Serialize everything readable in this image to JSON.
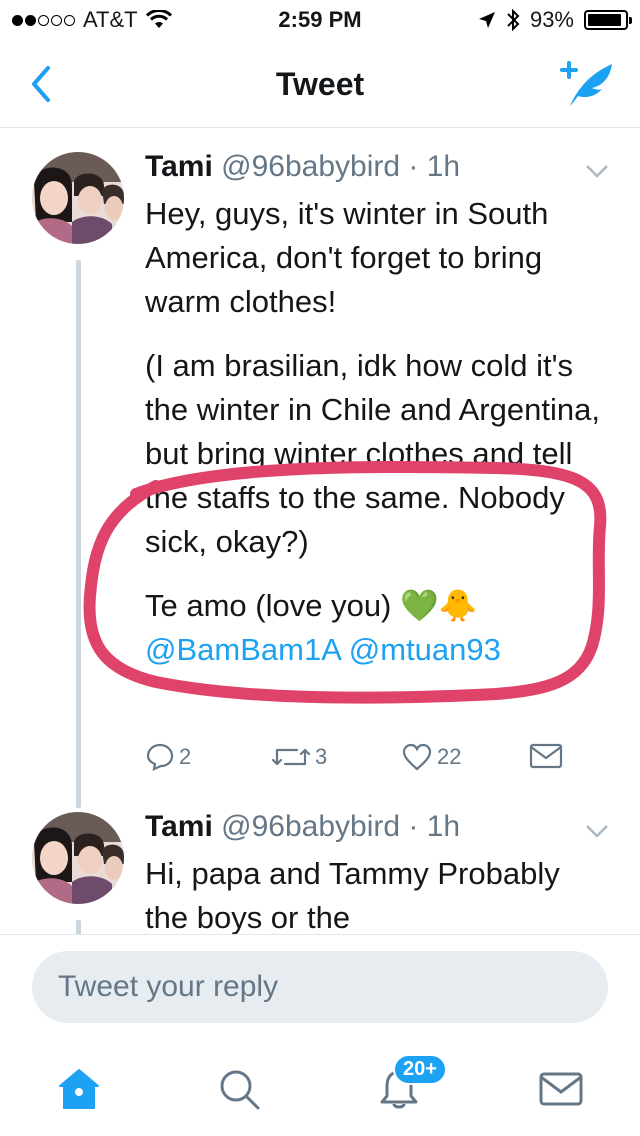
{
  "status_bar": {
    "carrier": "AT&T",
    "time": "2:59 PM",
    "battery": "93%",
    "battery_level": 0.93
  },
  "nav": {
    "title": "Tweet"
  },
  "tweets": [
    {
      "name": "Tami",
      "meta": "@96babybird · 1h",
      "paragraphs": [
        "Hey, guys, it's winter in South America, don't forget to bring warm clothes!",
        "(I am brasilian, idk how cold it's the winter in Chile and Argentina, but bring winter clothes and tell the staffs to the same. Nobody sick, okay?)",
        "Te amo (love you) 💚🐥"
      ],
      "mentions": "@BamBam1A @mtuan93",
      "replies": "2",
      "retweets": "3",
      "likes": "22"
    },
    {
      "name": "Tami",
      "meta": "@96babybird · 1h",
      "text": "Hi, papa and Tammy Probably the boys or the"
    }
  ],
  "reply": {
    "placeholder": "Tweet your reply"
  },
  "tabs": {
    "notifications_badge": "20+"
  },
  "colors": {
    "accent": "#1da1f2",
    "highlight": "#e0436a",
    "muted": "#657786"
  }
}
